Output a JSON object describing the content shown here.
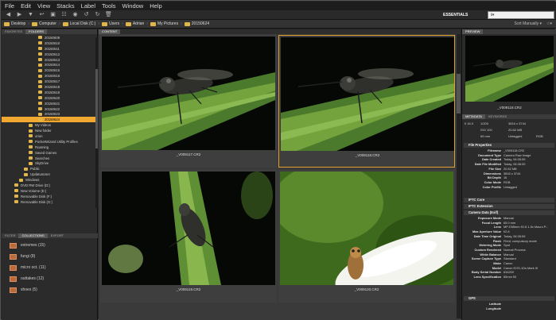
{
  "menu": [
    "File",
    "Edit",
    "View",
    "Stacks",
    "Label",
    "Tools",
    "Window",
    "Help"
  ],
  "workspace": "ESSENTIALS",
  "search_placeholder": "ℹ▾",
  "path": [
    "Desktop",
    "Computer",
    "Local Disk (C:)",
    "Users",
    "Adrian",
    "My Pictures",
    "20150624"
  ],
  "path_right": [
    "Sort Manually ▾",
    "☆▾"
  ],
  "left_tabs": [
    "FAVORITES",
    "FOLDERS"
  ],
  "tree": [
    {
      "label": "20150609",
      "indent": 2
    },
    {
      "label": "20150610",
      "indent": 2
    },
    {
      "label": "20150611",
      "indent": 2
    },
    {
      "label": "20150612",
      "indent": 2
    },
    {
      "label": "20150613",
      "indent": 2
    },
    {
      "label": "20150614",
      "indent": 2
    },
    {
      "label": "20150615",
      "indent": 2
    },
    {
      "label": "20150616",
      "indent": 2
    },
    {
      "label": "20150617",
      "indent": 2
    },
    {
      "label": "20150618",
      "indent": 2
    },
    {
      "label": "20150619",
      "indent": 2
    },
    {
      "label": "20150620",
      "indent": 2
    },
    {
      "label": "20150621",
      "indent": 2
    },
    {
      "label": "20150622",
      "indent": 2
    },
    {
      "label": "20150623",
      "indent": 2
    },
    {
      "label": "20150624",
      "indent": 2,
      "selected": true
    },
    {
      "label": "My Videos",
      "indent": 1
    },
    {
      "label": "New folder",
      "indent": 1
    },
    {
      "label": "orion",
      "indent": 1
    },
    {
      "label": "PocketWizard Utility Profiles",
      "indent": 1
    },
    {
      "label": "Roaming",
      "indent": 1
    },
    {
      "label": "Saved Games",
      "indent": 1
    },
    {
      "label": "Searches",
      "indent": 1
    },
    {
      "label": "SkyDrive",
      "indent": 1
    },
    {
      "label": "Public",
      "indent": 0.5
    },
    {
      "label": "UpdatusUser",
      "indent": 0.5
    },
    {
      "label": "Windows",
      "indent": 0
    },
    {
      "label": "DVD RW Drive (D:)",
      "indent": -0.5
    },
    {
      "label": "New Volume (E:)",
      "indent": -0.5
    },
    {
      "label": "Removable Disk (F:)",
      "indent": -0.5
    },
    {
      "label": "Removable Disk (G:)",
      "indent": -0.5
    }
  ],
  "bottom_tabs": [
    "FILTER",
    "COLLECTIONS",
    "EXPORT"
  ],
  "collections": [
    {
      "label": "extremes (15)"
    },
    {
      "label": "fungi (8)"
    },
    {
      "label": "micro oct. (11)"
    },
    {
      "label": "outtakes (12)"
    },
    {
      "label": "shoes (5)"
    }
  ],
  "content_tab": "CONTENT",
  "thumbs": [
    {
      "caption": "_V009117.CR2"
    },
    {
      "caption": "_V009118.CR2"
    },
    {
      "caption": "_V009119.CR2"
    },
    {
      "caption": "_V009120.CR2"
    }
  ],
  "preview_tab": "PREVIEW",
  "preview_caption": "_V009118.CR2",
  "meta_tabs": [
    "METADATA",
    "KEYWORDS"
  ],
  "meta_top": {
    "aperture": "f/ 16.0",
    "shutter": "1/200",
    "dims": "3816 x 3744",
    "size": "20.82 MB",
    "iso": "ISO 100",
    "rating": "Untagged",
    "mm": "65 mm",
    "rgb": "RGB"
  },
  "sections": {
    "file_properties": "File Properties",
    "iptc_core": "IPTC Core",
    "iptc_ext": "IPTC Extension",
    "camera_data": "Camera Data (Exif)",
    "gps": "GPS"
  },
  "file_props": [
    {
      "k": "Filename",
      "v": "_V009118.CR2"
    },
    {
      "k": "Document Type",
      "v": "Camera Raw image"
    },
    {
      "k": "Date Created",
      "v": "Today, 06:35:59"
    },
    {
      "k": "Date File Modified",
      "v": "Today, 06:36:00"
    },
    {
      "k": "File Size",
      "v": "20.82 MB"
    },
    {
      "k": "Dimensions",
      "v": "3816 x 3744"
    },
    {
      "k": "Bit Depth",
      "v": "16"
    },
    {
      "k": "Color Mode",
      "v": "RGB"
    },
    {
      "k": "Color Profile",
      "v": "Untagged"
    }
  ],
  "camera_props": [
    {
      "k": "Exposure Mode",
      "v": "Manual"
    },
    {
      "k": "Focal Length",
      "v": "65.0 mm"
    },
    {
      "k": "Lens",
      "v": "MP-E65mm f/2.8 1-5x Macro P..."
    },
    {
      "k": "Max Aperture Value",
      "v": "f/2.8"
    },
    {
      "k": "Date Time Original",
      "v": "Today, 06:35:59"
    },
    {
      "k": "Flash",
      "v": "Fired, compulsory mode"
    },
    {
      "k": "Metering Mode",
      "v": "Spot"
    },
    {
      "k": "Custom Rendered",
      "v": "Normal Process"
    },
    {
      "k": "White Balance",
      "v": "Manual"
    },
    {
      "k": "Scene Capture Type",
      "v": "Standard"
    },
    {
      "k": "Make",
      "v": "Canon"
    },
    {
      "k": "Model",
      "v": "Canon EOS-1Ds Mark III"
    },
    {
      "k": "Body Serial Number",
      "v": "634200"
    },
    {
      "k": "Lens Specification",
      "v": "65mm f/0"
    }
  ],
  "gps_props": [
    {
      "k": "Latitude",
      "v": ""
    },
    {
      "k": "Longitude",
      "v": ""
    }
  ]
}
